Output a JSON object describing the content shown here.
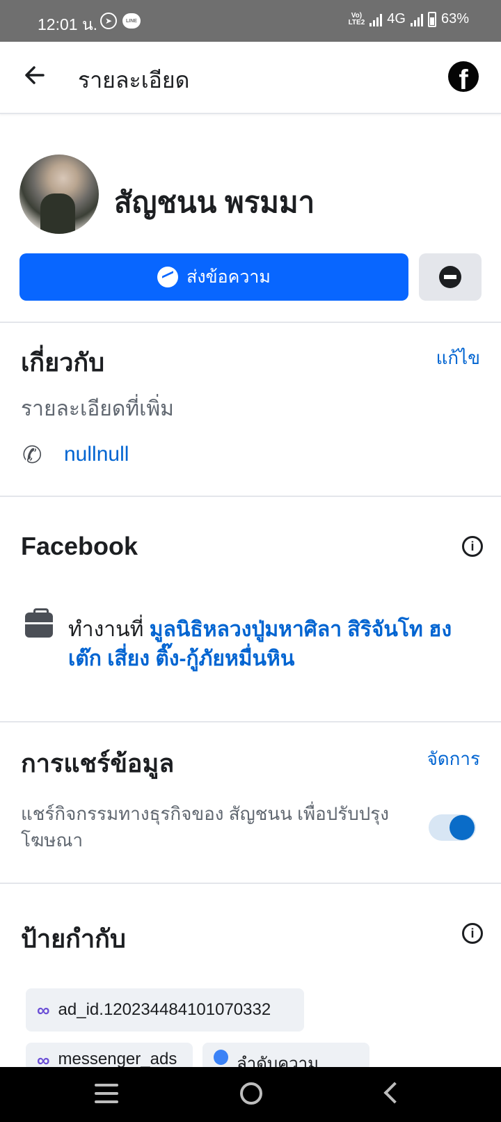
{
  "status_bar": {
    "time": "12:01 น.",
    "volte": "Vo)) LTE2",
    "network": "4G",
    "battery": "63%"
  },
  "app_bar": {
    "back_icon": "arrow-left-icon",
    "title": "รายละเอียด",
    "logo": "f"
  },
  "profile": {
    "name": "สัญชนน พรมมา",
    "message_button": "ส่งข้อความ"
  },
  "about": {
    "title": "เกี่ยวกับ",
    "edit": "แก้ไข",
    "subtitle": "รายละเอียดที่เพิ่ม",
    "phone": "nullnull"
  },
  "facebook": {
    "title": "Facebook",
    "work_prefix": "ทำงานที่ ",
    "work_place": "มูลนิธิหลวงปู่มหาศิลา สิริจันโท ฮงเต๊ก เสี่ยง ติ๊ง-กู้ภัยหมื่นหิน"
  },
  "sharing": {
    "title": "การแชร์ข้อมูล",
    "manage": "จัดการ",
    "description": "แชร์กิจกรรมทางธุรกิจของ สัญชนน เพื่อปรับปรุงโฆษณา",
    "enabled": true
  },
  "labels": {
    "title": "ป้ายกำกับ",
    "tags": [
      "ad_id.120234484101070332",
      "messenger_ads",
      "ลำดับความสำคัญ"
    ]
  },
  "colors": {
    "accent": "#0866ff",
    "link": "#0064d1"
  }
}
